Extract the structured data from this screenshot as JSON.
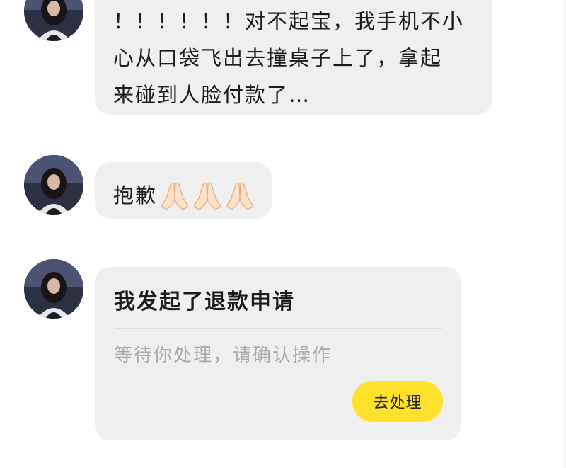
{
  "messages": [
    {
      "text": "！！！！！！对不起宝，我手机不小\n心从口袋飞出去撞桌子上了，拿起\n来碰到人脸付款了…"
    },
    {
      "text": "抱歉",
      "emoji": [
        "folded-hands-icon",
        "folded-hands-icon",
        "folded-hands-icon"
      ]
    },
    {
      "card": {
        "title": "我发起了退款申请",
        "subtitle": "等待你处理，请确认操作",
        "button_label": "去处理"
      }
    }
  ],
  "colors": {
    "bubble_bg": "#efefef",
    "button_bg": "#ffe02a",
    "subtitle_text": "#a9a9a9"
  }
}
